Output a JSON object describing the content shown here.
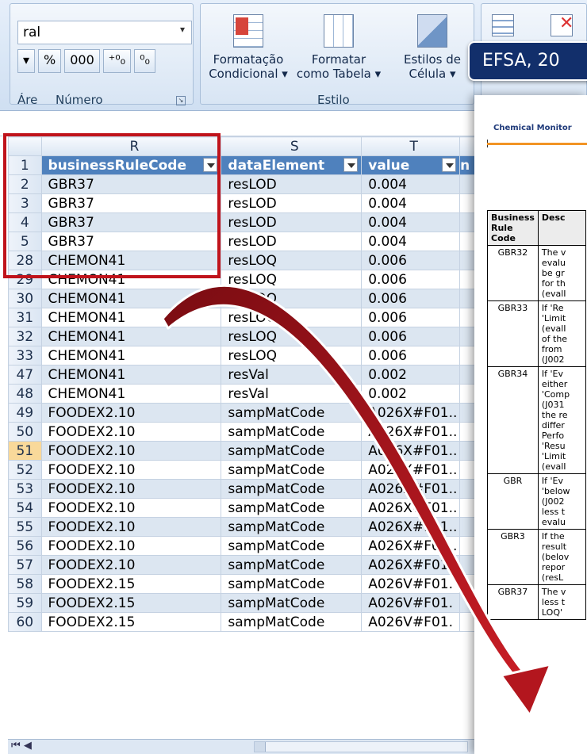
{
  "ribbon": {
    "number_format_value": "ral",
    "number_buttons": [
      "%",
      "000",
      "⁺⁰₀",
      "⁰₀"
    ],
    "number_group_label": "Número",
    "area_label": "Áre",
    "style_group_label": "Estilo",
    "conditional_format_line1": "Formatação",
    "conditional_format_line2": "Condicional ▾",
    "format_table_line1": "Formatar",
    "format_table_line2": "como Tabela ▾",
    "cell_styles_line1": "Estilos de",
    "cell_styles_line2": "Célula ▾"
  },
  "badge": {
    "text": "EFSA, 20"
  },
  "sheet": {
    "columns": [
      "R",
      "S",
      "T"
    ],
    "header_row": {
      "row": "1",
      "R": "businessRuleCode",
      "S": "dataElement",
      "T": "value",
      "U": "n"
    },
    "rows": [
      {
        "row": "2",
        "R": "GBR37",
        "S": "resLOD",
        "T": "0.004",
        "band": true
      },
      {
        "row": "3",
        "R": "GBR37",
        "S": "resLOD",
        "T": "0.004",
        "band": false
      },
      {
        "row": "4",
        "R": "GBR37",
        "S": "resLOD",
        "T": "0.004",
        "band": true
      },
      {
        "row": "5",
        "R": "GBR37",
        "S": "resLOD",
        "T": "0.004",
        "band": false
      },
      {
        "row": "28",
        "R": "CHEMON41",
        "S": "resLOQ",
        "T": "0.006",
        "band": true
      },
      {
        "row": "29",
        "R": "CHEMON41",
        "S": "resLOQ",
        "T": "0.006",
        "band": false
      },
      {
        "row": "30",
        "R": "CHEMON41",
        "S": "resLOQ",
        "T": "0.006",
        "band": true
      },
      {
        "row": "31",
        "R": "CHEMON41",
        "S": "resLOQ",
        "T": "0.006",
        "band": false
      },
      {
        "row": "32",
        "R": "CHEMON41",
        "S": "resLOQ",
        "T": "0.006",
        "band": true
      },
      {
        "row": "33",
        "R": "CHEMON41",
        "S": "resLOQ",
        "T": "0.006",
        "band": false
      },
      {
        "row": "47",
        "R": "CHEMON41",
        "S": "resVal",
        "T": "0.002",
        "band": true
      },
      {
        "row": "48",
        "R": "CHEMON41",
        "S": "resVal",
        "T": "0.002",
        "band": false
      },
      {
        "row": "49",
        "R": "FOODEX2.10",
        "S": "sampMatCode",
        "T": "A026X#F01..",
        "band": true
      },
      {
        "row": "50",
        "R": "FOODEX2.10",
        "S": "sampMatCode",
        "T": "A026X#F01..",
        "band": false
      },
      {
        "row": "51",
        "R": "FOODEX2.10",
        "S": "sampMatCode",
        "T": "A026X#F01..",
        "band": true,
        "selected": true
      },
      {
        "row": "52",
        "R": "FOODEX2.10",
        "S": "sampMatCode",
        "T": "A026X#F01..",
        "band": false
      },
      {
        "row": "53",
        "R": "FOODEX2.10",
        "S": "sampMatCode",
        "T": "A026X#F01..",
        "band": true
      },
      {
        "row": "54",
        "R": "FOODEX2.10",
        "S": "sampMatCode",
        "T": "A026X#F01..",
        "band": false
      },
      {
        "row": "55",
        "R": "FOODEX2.10",
        "S": "sampMatCode",
        "T": "A026X#F01..",
        "band": true
      },
      {
        "row": "56",
        "R": "FOODEX2.10",
        "S": "sampMatCode",
        "T": "A026X#F01..",
        "band": false
      },
      {
        "row": "57",
        "R": "FOODEX2.10",
        "S": "sampMatCode",
        "T": "A026X#F01..",
        "band": true
      },
      {
        "row": "58",
        "R": "FOODEX2.15",
        "S": "sampMatCode",
        "T": "A026V#F01.",
        "band": false
      },
      {
        "row": "59",
        "R": "FOODEX2.15",
        "S": "sampMatCode",
        "T": "A026V#F01.",
        "band": true
      },
      {
        "row": "60",
        "R": "FOODEX2.15",
        "S": "sampMatCode",
        "T": "A026V#F01.",
        "band": false
      }
    ]
  },
  "document": {
    "header": "Chemical Monitor",
    "table_headers": [
      "Business Rule Code",
      "Desc"
    ],
    "rows": [
      {
        "code": "GBR32",
        "desc": [
          "The v",
          "evalu",
          "be gr",
          "for th",
          "(evalI"
        ]
      },
      {
        "code": "GBR33",
        "desc": [
          "If 'Re",
          "'Limit",
          "(evalI",
          "of the",
          "from",
          "(J002"
        ]
      },
      {
        "code": "GBR34",
        "desc": [
          "If 'Ev",
          "either",
          "'Comp",
          "(J031",
          "the re",
          "differ",
          "Perfo",
          "'Resu",
          "'Limit",
          "(evalI"
        ]
      },
      {
        "code": "GBR",
        "desc": [
          "If 'Ev",
          "'below",
          "(J002",
          "less t",
          "evalu"
        ]
      },
      {
        "code": "GBR3",
        "desc": [
          "If the",
          "result",
          "(belov",
          "repor",
          "(resL"
        ]
      },
      {
        "code": "GBR37",
        "desc": [
          "The v",
          "less t",
          "LOQ'"
        ]
      }
    ]
  },
  "colors": {
    "highlight": "#c0131b",
    "arrow": "#a3121a",
    "table_header": "#4f81bd",
    "band": "#dce6f1",
    "badge": "#122f6b"
  }
}
